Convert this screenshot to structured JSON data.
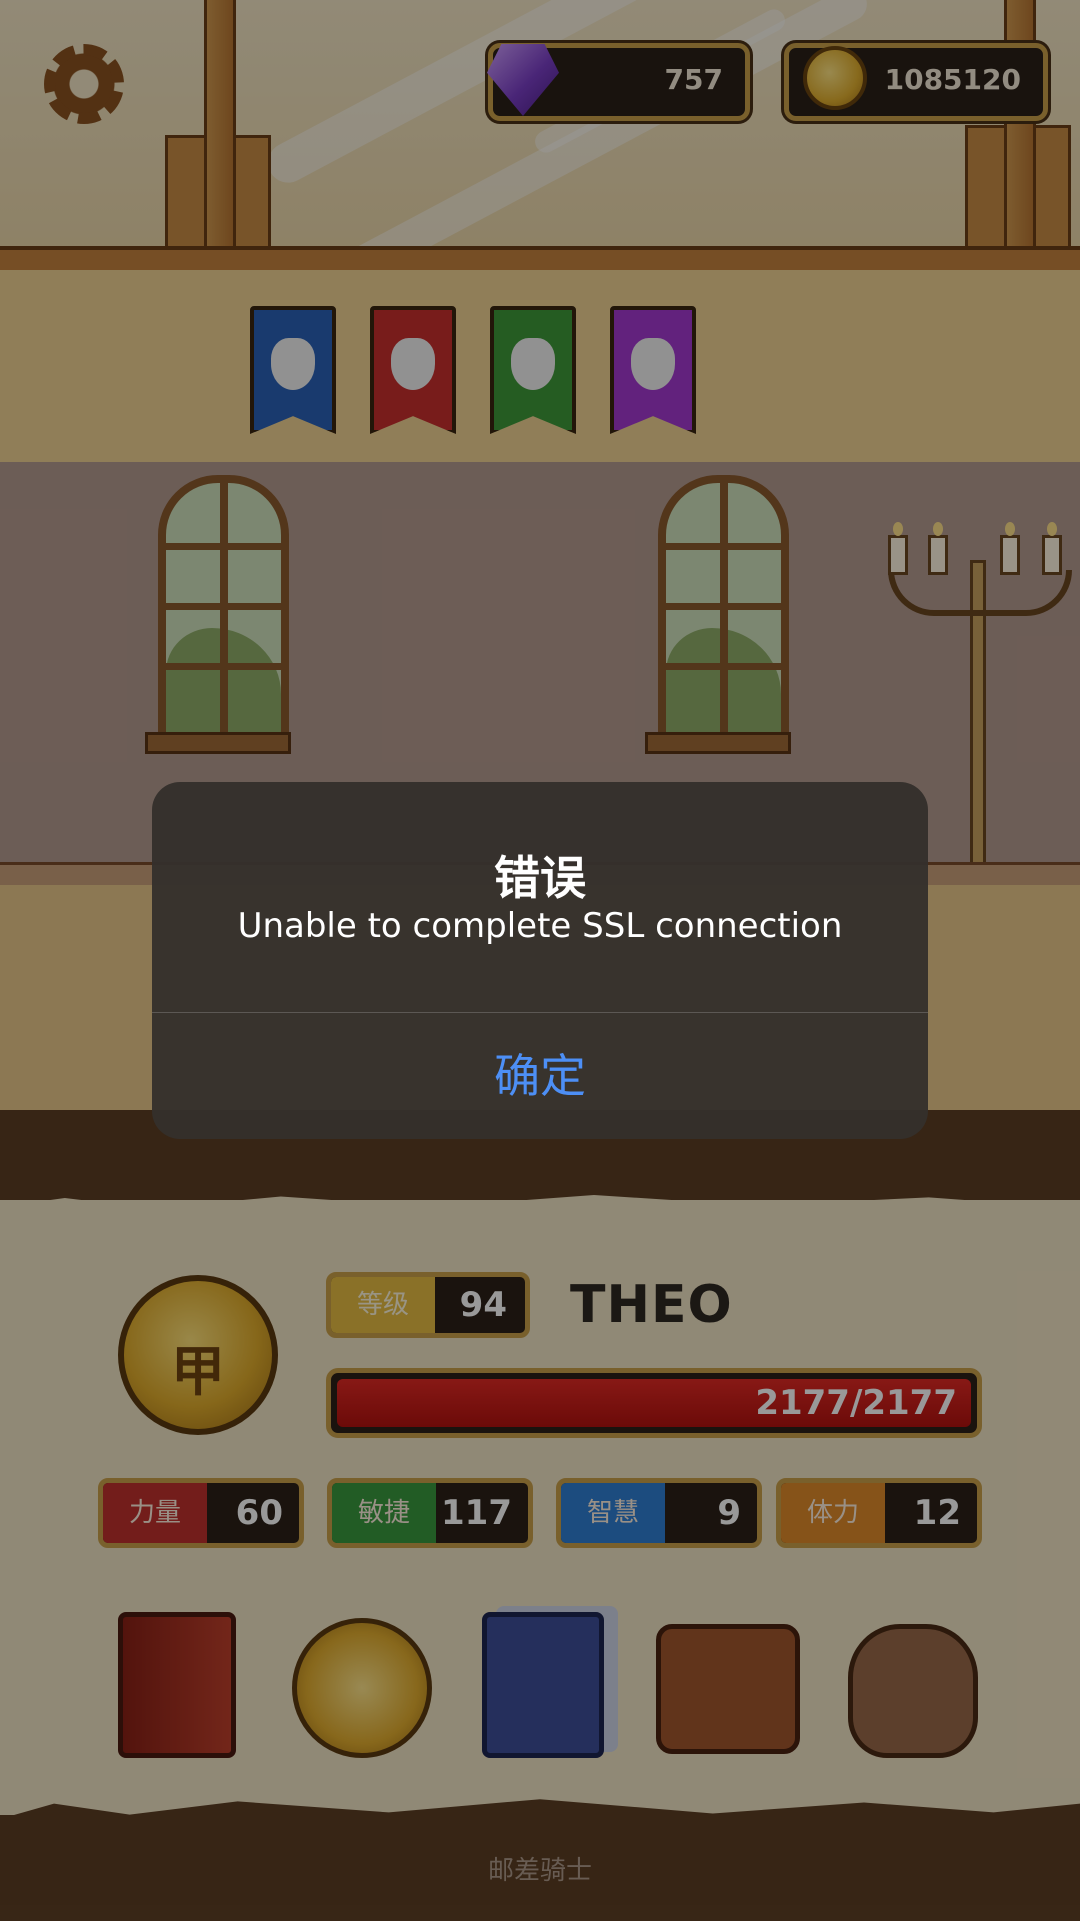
{
  "currency": {
    "gems": "757",
    "gold": "1085120"
  },
  "player": {
    "level_label": "等级",
    "level": "94",
    "name": "THEO",
    "hp_text": "2177/2177",
    "hp_fraction": 1.0,
    "rank_char": "甲"
  },
  "stats": [
    {
      "label": "力量",
      "value": "60",
      "color": "#c0312d"
    },
    {
      "label": "敏捷",
      "value": "117",
      "color": "#3a9a3e"
    },
    {
      "label": "智慧",
      "value": "9",
      "color": "#2f7fd4"
    },
    {
      "label": "体力",
      "value": "12",
      "color": "#e08a2a"
    }
  ],
  "banners": [
    {
      "color": "#2b62b8",
      "icon": "castle-icon"
    },
    {
      "color": "#c9302e",
      "icon": "phoenix-icon"
    },
    {
      "color": "#3f9a3a",
      "icon": "knight-icon"
    },
    {
      "color": "#a43ad0",
      "icon": "swan-icon"
    }
  ],
  "menu": [
    "hero-book-icon",
    "star-coin-icon",
    "cards-icon",
    "satchel-icon",
    "treasure-bag-icon"
  ],
  "app_name": "邮差骑士",
  "dialog": {
    "title": "错误",
    "message": "Unable to complete SSL connection",
    "button": "确定",
    "button_color": "#4d8ff5"
  }
}
